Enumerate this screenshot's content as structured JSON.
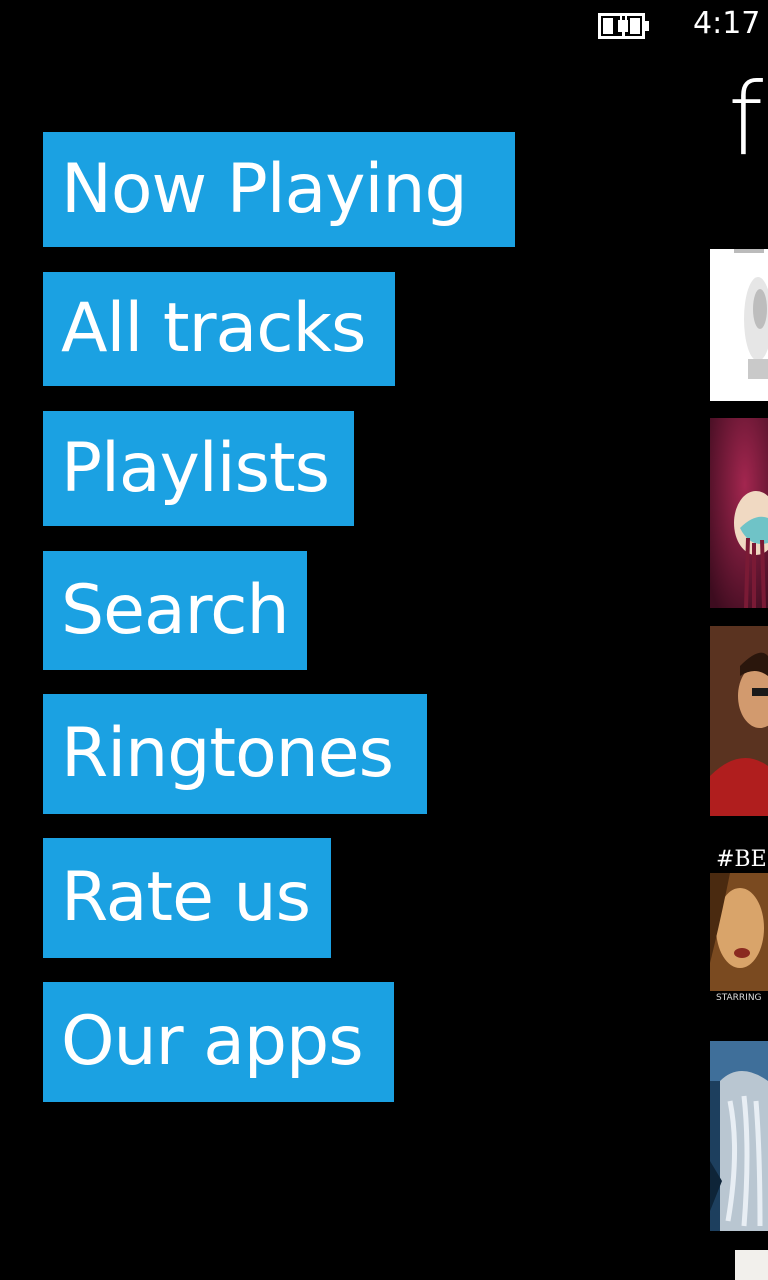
{
  "status_bar": {
    "time": "4:17",
    "battery_icon": "battery-charging-icon"
  },
  "page": {
    "title": "fo"
  },
  "menu": {
    "items": [
      {
        "label": "Now Playing"
      },
      {
        "label": "All tracks"
      },
      {
        "label": "Playlists"
      },
      {
        "label": "Search"
      },
      {
        "label": "Ringtones"
      },
      {
        "label": "Rate us"
      },
      {
        "label": "Our apps"
      }
    ]
  },
  "albums": {
    "visible_text": [
      "#BE",
      "STARRING"
    ]
  },
  "colors": {
    "accent": "#1ba1e2",
    "background": "#000000",
    "text": "#ffffff"
  }
}
